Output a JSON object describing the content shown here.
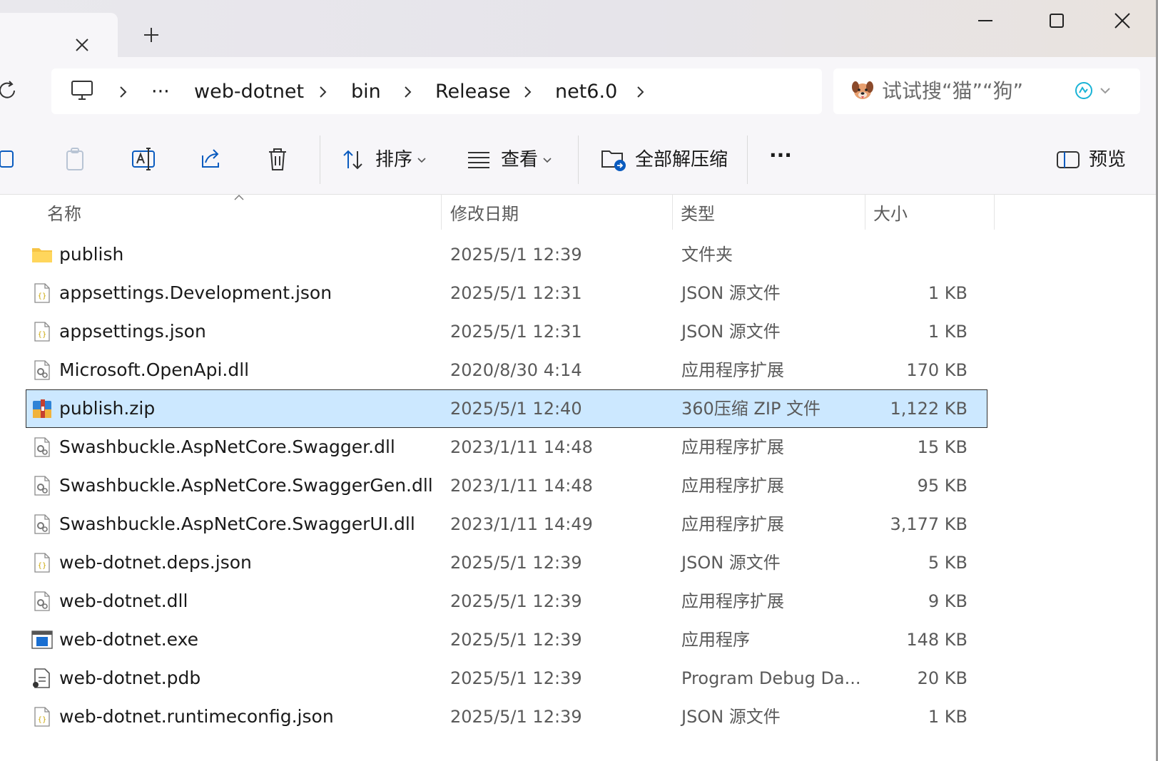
{
  "window": {
    "tab_add_symbol": "+"
  },
  "breadcrumb": {
    "overflow": "···",
    "items": [
      "web-dotnet",
      "bin",
      "Release",
      "net6.0"
    ]
  },
  "search": {
    "placeholder": "试试搜“猫”“狗”"
  },
  "toolbar": {
    "sort_label": "排序",
    "view_label": "查看",
    "extract_label": "全部解压缩",
    "more_label": "···",
    "preview_label": "预览"
  },
  "columns": {
    "name": "名称",
    "date": "修改日期",
    "type": "类型",
    "size": "大小"
  },
  "files": [
    {
      "name": "publish",
      "date": "2025/5/1 12:39",
      "type": "文件夹",
      "size": "",
      "icon": "folder-icon"
    },
    {
      "name": "appsettings.Development.json",
      "date": "2025/5/1 12:31",
      "type": "JSON 源文件",
      "size": "1 KB",
      "icon": "json-file-icon"
    },
    {
      "name": "appsettings.json",
      "date": "2025/5/1 12:31",
      "type": "JSON 源文件",
      "size": "1 KB",
      "icon": "json-file-icon"
    },
    {
      "name": "Microsoft.OpenApi.dll",
      "date": "2020/8/30 4:14",
      "type": "应用程序扩展",
      "size": "170 KB",
      "icon": "dll-file-icon"
    },
    {
      "name": "publish.zip",
      "date": "2025/5/1 12:40",
      "type": "360压缩 ZIP 文件",
      "size": "1,122 KB",
      "icon": "zip-file-icon",
      "selected": true
    },
    {
      "name": "Swashbuckle.AspNetCore.Swagger.dll",
      "date": "2023/1/11 14:48",
      "type": "应用程序扩展",
      "size": "15 KB",
      "icon": "dll-file-icon"
    },
    {
      "name": "Swashbuckle.AspNetCore.SwaggerGen.dll",
      "date": "2023/1/11 14:48",
      "type": "应用程序扩展",
      "size": "95 KB",
      "icon": "dll-file-icon"
    },
    {
      "name": "Swashbuckle.AspNetCore.SwaggerUI.dll",
      "date": "2023/1/11 14:49",
      "type": "应用程序扩展",
      "size": "3,177 KB",
      "icon": "dll-file-icon"
    },
    {
      "name": "web-dotnet.deps.json",
      "date": "2025/5/1 12:39",
      "type": "JSON 源文件",
      "size": "5 KB",
      "icon": "json-file-icon"
    },
    {
      "name": "web-dotnet.dll",
      "date": "2025/5/1 12:39",
      "type": "应用程序扩展",
      "size": "9 KB",
      "icon": "dll-file-icon"
    },
    {
      "name": "web-dotnet.exe",
      "date": "2025/5/1 12:39",
      "type": "应用程序",
      "size": "148 KB",
      "icon": "exe-file-icon"
    },
    {
      "name": "web-dotnet.pdb",
      "date": "2025/5/1 12:39",
      "type": "Program Debug Da...",
      "size": "20 KB",
      "icon": "pdb-file-icon"
    },
    {
      "name": "web-dotnet.runtimeconfig.json",
      "date": "2025/5/1 12:39",
      "type": "JSON 源文件",
      "size": "1 KB",
      "icon": "json-file-icon"
    }
  ]
}
